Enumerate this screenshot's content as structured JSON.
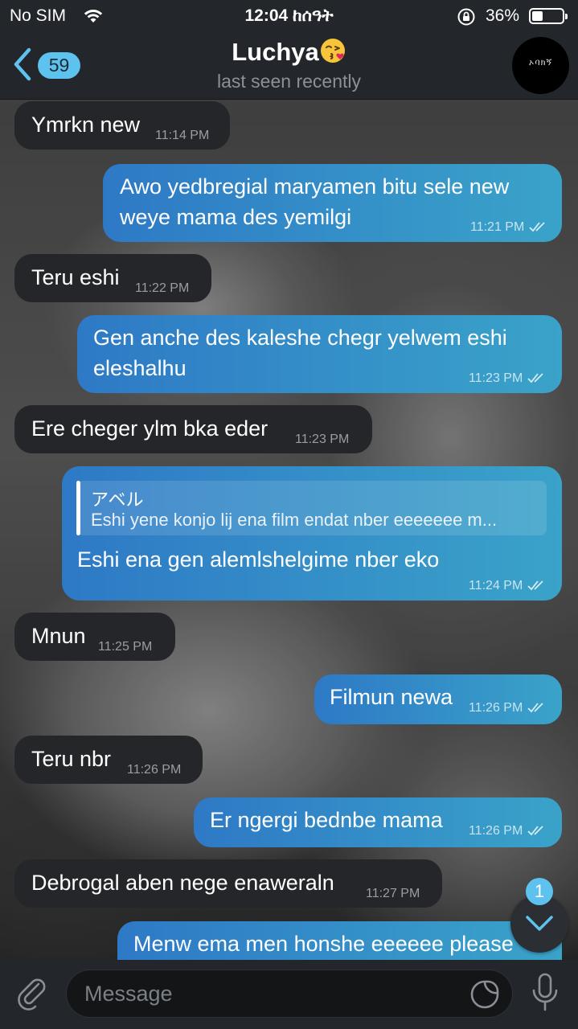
{
  "status_bar": {
    "carrier": "No SIM",
    "time": "12:04 ከሰዓት",
    "battery_percent": "36%",
    "battery_level": 0.36
  },
  "header": {
    "back_badge": "59",
    "title": "Luchya",
    "title_emoji": "face-blowing-a-kiss",
    "subtitle": "last seen recently",
    "avatar_text": "ኦባክኝ"
  },
  "messages": [
    {
      "direction": "in",
      "text": "Ymrkn new",
      "time": "11:14 PM"
    },
    {
      "direction": "out",
      "lines": [
        "Awo yedbregial maryamen bitu sele new",
        "weye mama des yemilgi"
      ],
      "time": "11:21 PM",
      "read": true
    },
    {
      "direction": "in",
      "text": "Teru eshi",
      "time": "11:22 PM"
    },
    {
      "direction": "out",
      "lines": [
        "Gen anche des kaleshe chegr yelwem eshi",
        "eleshalhu"
      ],
      "time": "11:23 PM",
      "read": true
    },
    {
      "direction": "in",
      "text": "Ere cheger ylm bka eder",
      "time": "11:23 PM"
    },
    {
      "direction": "out",
      "reply": {
        "author": "アベル",
        "text": "Eshi yene konjo lij ena film endat nber eeeeeee m..."
      },
      "text": "Eshi ena gen alemlshelgime nber eko",
      "time": "11:24 PM",
      "read": true
    },
    {
      "direction": "in",
      "text": "Mnun",
      "time": "11:25 PM"
    },
    {
      "direction": "out",
      "text": "Filmun newa",
      "time": "11:26 PM",
      "read": true
    },
    {
      "direction": "in",
      "text": "Teru nbr",
      "time": "11:26 PM"
    },
    {
      "direction": "out",
      "text": "Er ngergi bednbe mama",
      "time": "11:26 PM",
      "read": true
    },
    {
      "direction": "in",
      "text": "Debrogal aben nege enaweraln",
      "time": "11:27 PM"
    },
    {
      "direction": "out",
      "text": "Menw ema men honshe eeeeee please",
      "time": ""
    }
  ],
  "scroll_down": {
    "badge": "1"
  },
  "composer": {
    "placeholder": "Message"
  },
  "colors": {
    "accent": "#5ec2ee",
    "incoming_bubble": "#242629",
    "outgoing_bubble_start": "#2e79c6",
    "outgoing_bubble_end": "#3aa3c9",
    "bar_background": "#23262b"
  }
}
